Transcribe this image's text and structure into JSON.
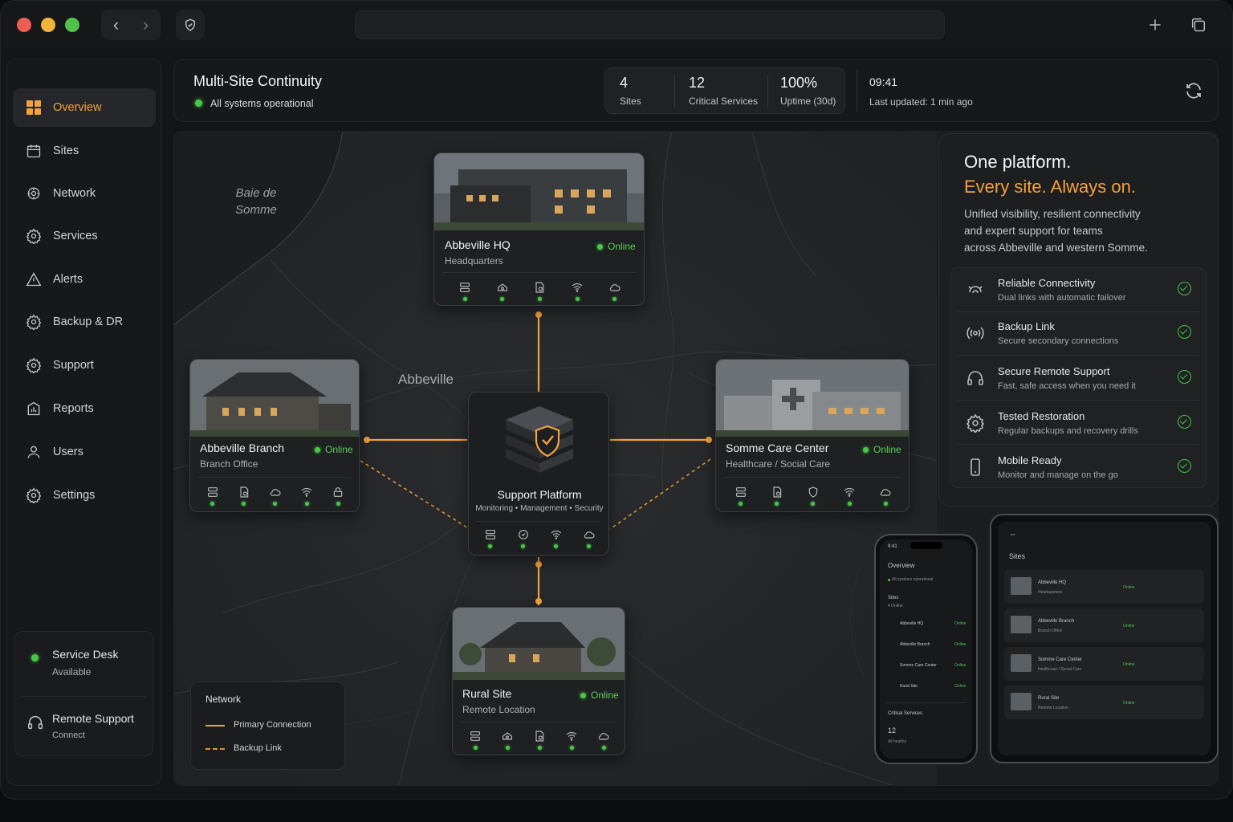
{
  "colors": {
    "accent": "#f4a23c",
    "online": "#48c848",
    "bg": "#141516"
  },
  "window": {
    "controls": [
      "close",
      "minimize",
      "maximize"
    ]
  },
  "sidebar": {
    "items": [
      {
        "label": "Overview",
        "icon": "grid-icon"
      },
      {
        "label": "Sites",
        "icon": "calendar-icon"
      },
      {
        "label": "Network",
        "icon": "network-icon"
      },
      {
        "label": "Services",
        "icon": "gear-icon"
      },
      {
        "label": "Alerts",
        "icon": "alert-icon"
      },
      {
        "label": "Backup & DR",
        "icon": "backup-icon"
      },
      {
        "label": "Support",
        "icon": "support-icon"
      },
      {
        "label": "Reports",
        "icon": "reports-icon"
      },
      {
        "label": "Users",
        "icon": "user-icon"
      },
      {
        "label": "Settings",
        "icon": "settings-icon"
      }
    ],
    "service_desk": {
      "title": "Service Desk",
      "status": "Available"
    },
    "remote_support": {
      "title": "Remote Support",
      "action": "Connect"
    }
  },
  "header": {
    "title": "Multi-Site Continuity",
    "status": "All systems operational",
    "stats": [
      {
        "value": "4",
        "label": "Sites"
      },
      {
        "value": "12",
        "label": "Critical Services"
      },
      {
        "value": "100%",
        "label": "Uptime (30d)"
      }
    ],
    "time": "09:41",
    "last_updated": "Last updated: 1 min ago"
  },
  "map": {
    "labels": {
      "bay": "Baie de\nSomme",
      "bay_line1": "Baie de",
      "bay_line2": "Somme",
      "town": "Abbeville"
    },
    "hub": {
      "title": "Support Platform",
      "subtitle": "Monitoring • Management • Security"
    },
    "sites": [
      {
        "name": "Abbeville HQ",
        "type": "Headquarters",
        "status": "Online"
      },
      {
        "name": "Abbeville Branch",
        "type": "Branch Office",
        "status": "Online"
      },
      {
        "name": "Somme Care Center",
        "type": "Healthcare / Social Care",
        "status": "Online"
      },
      {
        "name": "Rural Site",
        "type": "Remote Location",
        "status": "Online"
      }
    ],
    "legend": {
      "title": "Network",
      "primary": "Primary Connection",
      "backup": "Backup Link"
    }
  },
  "panel": {
    "headline1": "One platform.",
    "headline2": "Every site. Always on.",
    "body": "Unified visibility, resilient connectivity and expert support for teams across Abbeville and western Somme.",
    "body_l1": "Unified visibility, resilient connectivity",
    "body_l2": "and expert support for teams",
    "body_l3": "across Abbeville and western Somme.",
    "features": [
      {
        "title": "Reliable Connectivity",
        "desc": "Dual links with automatic failover",
        "icon": "link-icon"
      },
      {
        "title": "Backup Link",
        "desc": "Secure secondary connections",
        "icon": "signal-icon"
      },
      {
        "title": "Secure Remote Support",
        "desc": "Fast, safe access when you need it",
        "icon": "headset-icon"
      },
      {
        "title": "Tested Restoration",
        "desc": "Regular backups and recovery drills",
        "icon": "restore-icon"
      },
      {
        "title": "Mobile Ready",
        "desc": "Monitor and manage on the go",
        "icon": "mobile-icon"
      }
    ]
  },
  "phone": {
    "time": "9:41",
    "title": "Overview",
    "status": "All systems operational",
    "sites_label": "Sites",
    "sites_count": "4 Online",
    "sites": [
      "Abbeville HQ",
      "Abbeville Branch",
      "Somme Care Center",
      "Rural Site"
    ],
    "online": "Online",
    "critical_label": "Critical Services",
    "critical_value": "12",
    "critical_status": "All healthy"
  },
  "tablet": {
    "title": "Sites",
    "sites": [
      {
        "name": "Abbeville HQ",
        "type": "Headquarters"
      },
      {
        "name": "Abbeville Branch",
        "type": "Branch Office"
      },
      {
        "name": "Somme Care Center",
        "type": "Healthcare / Social Care"
      },
      {
        "name": "Rural Site",
        "type": "Remote Location"
      }
    ],
    "online": "Online"
  }
}
